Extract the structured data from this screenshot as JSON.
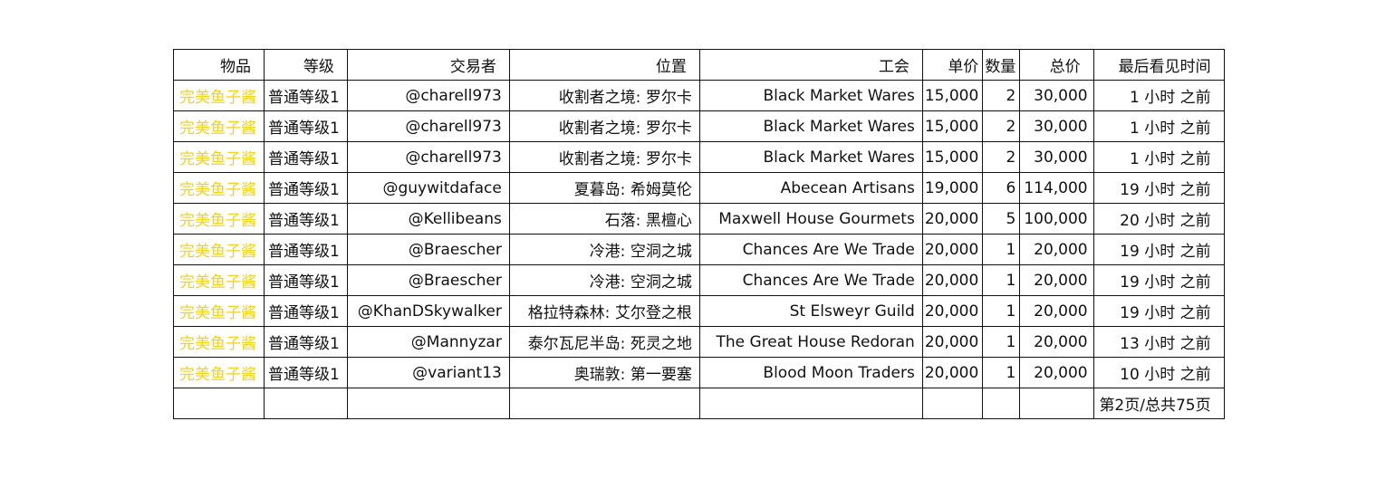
{
  "colors": {
    "item_quality": "#f2d31b",
    "border": "#111111",
    "text": "#111111",
    "background": "#ffffff"
  },
  "table": {
    "headers": {
      "item": "物品",
      "level": "等级",
      "trader": "交易者",
      "location": "位置",
      "guild": "工会",
      "unit_price": "单价",
      "quantity": "数量",
      "total_price": "总价",
      "last_seen": "最后看见时间"
    },
    "rows": [
      {
        "item": "完美鱼子酱",
        "level": "普通等级1",
        "trader": "@charell973",
        "location": "收割者之境: 罗尔卡",
        "guild": "Black Market Wares",
        "unit_price": "15,000",
        "quantity": "2",
        "total_price": "30,000",
        "last_seen": "1 小时 之前"
      },
      {
        "item": "完美鱼子酱",
        "level": "普通等级1",
        "trader": "@charell973",
        "location": "收割者之境: 罗尔卡",
        "guild": "Black Market Wares",
        "unit_price": "15,000",
        "quantity": "2",
        "total_price": "30,000",
        "last_seen": "1 小时 之前"
      },
      {
        "item": "完美鱼子酱",
        "level": "普通等级1",
        "trader": "@charell973",
        "location": "收割者之境: 罗尔卡",
        "guild": "Black Market Wares",
        "unit_price": "15,000",
        "quantity": "2",
        "total_price": "30,000",
        "last_seen": "1 小时 之前"
      },
      {
        "item": "完美鱼子酱",
        "level": "普通等级1",
        "trader": "@guywitdaface",
        "location": "夏暮岛: 希姆莫伦",
        "guild": "Abecean Artisans",
        "unit_price": "19,000",
        "quantity": "6",
        "total_price": "114,000",
        "last_seen": "19 小时 之前"
      },
      {
        "item": "完美鱼子酱",
        "level": "普通等级1",
        "trader": "@Kellibeans",
        "location": "石落: 黑檀心",
        "guild": "Maxwell House Gourmets",
        "unit_price": "20,000",
        "quantity": "5",
        "total_price": "100,000",
        "last_seen": "20 小时 之前"
      },
      {
        "item": "完美鱼子酱",
        "level": "普通等级1",
        "trader": "@Braescher",
        "location": "冷港: 空洞之城",
        "guild": "Chances Are We Trade",
        "unit_price": "20,000",
        "quantity": "1",
        "total_price": "20,000",
        "last_seen": "19 小时 之前"
      },
      {
        "item": "完美鱼子酱",
        "level": "普通等级1",
        "trader": "@Braescher",
        "location": "冷港: 空洞之城",
        "guild": "Chances Are We Trade",
        "unit_price": "20,000",
        "quantity": "1",
        "total_price": "20,000",
        "last_seen": "19 小时 之前"
      },
      {
        "item": "完美鱼子酱",
        "level": "普通等级1",
        "trader": "@KhanDSkywalker",
        "location": "格拉特森林: 艾尔登之根",
        "guild": "St Elsweyr Guild",
        "unit_price": "20,000",
        "quantity": "1",
        "total_price": "20,000",
        "last_seen": "19 小时 之前"
      },
      {
        "item": "完美鱼子酱",
        "level": "普通等级1",
        "trader": "@Mannyzar",
        "location": "泰尔瓦尼半岛: 死灵之地",
        "guild": "The Great House Redoran",
        "unit_price": "20,000",
        "quantity": "1",
        "total_price": "20,000",
        "last_seen": "13 小时 之前"
      },
      {
        "item": "完美鱼子酱",
        "level": "普通等级1",
        "trader": "@variant13",
        "location": "奥瑞敦: 第一要塞",
        "guild": "Blood Moon Traders",
        "unit_price": "20,000",
        "quantity": "1",
        "total_price": "20,000",
        "last_seen": "10 小时 之前"
      }
    ],
    "pagination": "第2页/总共75页"
  }
}
